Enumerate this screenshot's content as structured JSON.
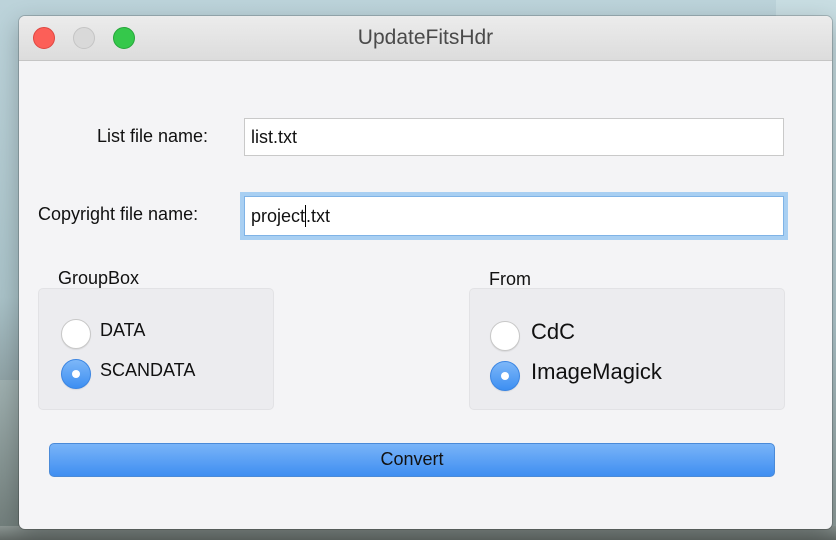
{
  "window": {
    "title": "UpdateFitsHdr"
  },
  "form": {
    "list_label": "List file name:",
    "list_value": "list.txt",
    "copyright_label": "Copyright file name:",
    "copyright_value_before_caret": "project",
    "copyright_value_after_caret": ".txt"
  },
  "groupbox": {
    "title": "GroupBox",
    "options": [
      {
        "label": "DATA",
        "checked": false
      },
      {
        "label": "SCANDATA",
        "checked": true
      }
    ]
  },
  "from": {
    "title": "From",
    "options": [
      {
        "label": "CdC",
        "checked": false
      },
      {
        "label": "ImageMagick",
        "checked": true
      }
    ]
  },
  "actions": {
    "convert_label": "Convert"
  },
  "colors": {
    "accent": "#3f8ef1",
    "focus_ring": "#a8cff2",
    "close": "#fc5f58",
    "maximize": "#35c84b"
  }
}
